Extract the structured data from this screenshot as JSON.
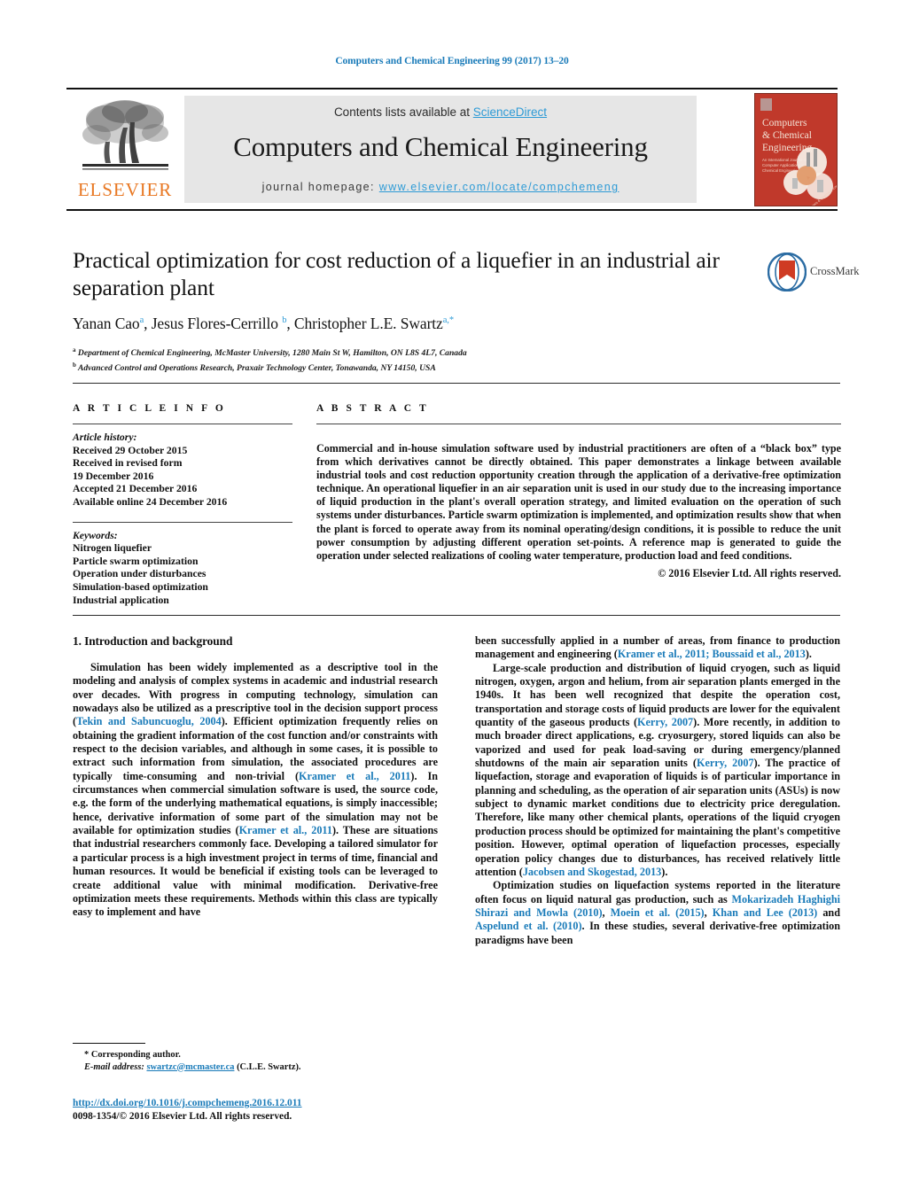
{
  "running_head": "Computers and Chemical Engineering 99 (2017) 13–20",
  "masthead": {
    "contents_prefix": "Contents lists available at ",
    "sciencedirect": "ScienceDirect",
    "journal_title": "Computers and Chemical Engineering",
    "homepage_label": "journal homepage:",
    "homepage_url": "www.elsevier.com/locate/compchemeng",
    "publisher": "ELSEVIER",
    "cover": {
      "line1": "Computers",
      "line2": "& Chemical",
      "line3": "Engineering",
      "sub1": "An International Journal of",
      "sub2": "Computer Applications in",
      "sub3": "Chemical Engineering"
    }
  },
  "article": {
    "title": "Practical optimization for cost reduction of a liquefier in an industrial air separation plant",
    "authors_html": "Yanan Cao<sup>a</sup>, Jesus Flores-Cerrillo <sup>b</sup>, Christopher L.E. Swartz<sup>a,*</sup>",
    "affiliation_a": "Department of Chemical Engineering, McMaster University, 1280 Main St W, Hamilton, ON L8S 4L7, Canada",
    "affiliation_b": "Advanced Control and Operations Research, Praxair Technology Center, Tonawanda, NY 14150, USA",
    "crossmark_label": "CrossMark"
  },
  "info": {
    "heading": "A R T I C L E   I N F O",
    "history_label": "Article history:",
    "history": [
      "Received 29 October 2015",
      "Received in revised form",
      "19 December 2016",
      "Accepted 21 December 2016",
      "Available online 24 December 2016"
    ],
    "keywords_label": "Keywords:",
    "keywords": [
      "Nitrogen liquefier",
      "Particle swarm optimization",
      "Operation under disturbances",
      "Simulation-based optimization",
      "Industrial application"
    ]
  },
  "abstract": {
    "heading": "A B S T R A C T",
    "text": "Commercial and in-house simulation software used by industrial practitioners are often of a “black box” type from which derivatives cannot be directly obtained. This paper demonstrates a linkage between available industrial tools and cost reduction opportunity creation through the application of a derivative-free optimization technique. An operational liquefier in an air separation unit is used in our study due to the increasing importance of liquid production in the plant's overall operation strategy, and limited evaluation on the operation of such systems under disturbances. Particle swarm optimization is implemented, and optimization results show that when the plant is forced to operate away from its nominal operating/design conditions, it is possible to reduce the unit power consumption by adjusting different operation set-points. A reference map is generated to guide the operation under selected realizations of cooling water temperature, production load and feed conditions.",
    "copyright": "© 2016 Elsevier Ltd. All rights reserved."
  },
  "body": {
    "section_heading": "1.  Introduction and background",
    "left_p1_html": "Simulation has been widely implemented as a descriptive tool in the modeling and analysis of complex systems in academic and industrial research over decades. With progress in computing technology, simulation can nowadays also be utilized as a prescriptive tool in the decision support process (<span class=\"ref\">Tekin and Sabuncuoglu, 2004</span>). Efficient optimization frequently relies on obtaining the gradient information of the cost function and/or constraints with respect to the decision variables, and although in some cases, it is possible to extract such information from simulation, the associated procedures are typically time-consuming and non-trivial (<span class=\"ref\">Kramer et al., 2011</span>). In circumstances when commercial simulation software is used, the source code, e.g. the form of the underlying mathematical equations, is simply inaccessible; hence, derivative information of some part of the simulation may not be available for optimization studies (<span class=\"ref\">Kramer et al., 2011</span>). These are situations that industrial researchers commonly face. Developing a tailored simulator for a particular process is a high investment project in terms of time, financial and human resources. It would be beneficial if existing tools can be leveraged to create additional value with minimal modification. Derivative-free optimization meets these requirements. Methods within this class are typically easy to implement and have",
    "right_p1_html": "been successfully applied in a number of areas, from finance to production management and engineering (<span class=\"ref\">Kramer et al., 2011; Boussaid et al., 2013</span>).",
    "right_p2_html": "Large-scale production and distribution of liquid cryogen, such as liquid nitrogen, oxygen, argon and helium, from air separation plants emerged in the 1940s. It has been well recognized that despite the operation cost, transportation and storage costs of liquid products are lower for the equivalent quantity of the gaseous products (<span class=\"ref\">Kerry, 2007</span>). More recently, in addition to much broader direct applications, e.g. cryosurgery, stored liquids can also be vaporized and used for peak load-saving or during emergency/planned shutdowns of the main air separation units (<span class=\"ref\">Kerry, 2007</span>). The practice of liquefaction, storage and evaporation of liquids is of particular importance in planning and scheduling, as the operation of air separation units (ASUs) is now subject to dynamic market conditions due to electricity price deregulation. Therefore, like many other chemical plants, operations of the liquid cryogen production process should be optimized for maintaining the plant's competitive position. However, optimal operation of liquefaction processes, especially operation policy changes due to disturbances, has received relatively little attention (<span class=\"ref\">Jacobsen and Skogestad, 2013</span>).",
    "right_p3_html": "Optimization studies on liquefaction systems reported in the literature often focus on liquid natural gas production, such as <span class=\"ref\">Mokarizadeh Haghighi Shirazi and Mowla (2010)</span>, <span class=\"ref\">Moein et al. (2015)</span>, <span class=\"ref\">Khan and Lee (2013)</span> and <span class=\"ref\">Aspelund et al. (2010)</span>. In these studies, several derivative-free optimization paradigms have been"
  },
  "footer": {
    "corresponding_marker": "*",
    "corresponding_label": "Corresponding author.",
    "email_label": "E-mail address:",
    "email": "swartzc@mcmaster.ca",
    "email_owner": "(C.L.E. Swartz).",
    "doi": "http://dx.doi.org/10.1016/j.compchemeng.2016.12.011",
    "issn_line": "0098-1354/© 2016 Elsevier Ltd. All rights reserved."
  },
  "colors": {
    "link": "#1a7bb9",
    "sciencedirect": "#2e9bd6",
    "elsevier_orange": "#e87722",
    "cover_red": "#c0392b",
    "panel_grey": "#e6e6e6"
  }
}
